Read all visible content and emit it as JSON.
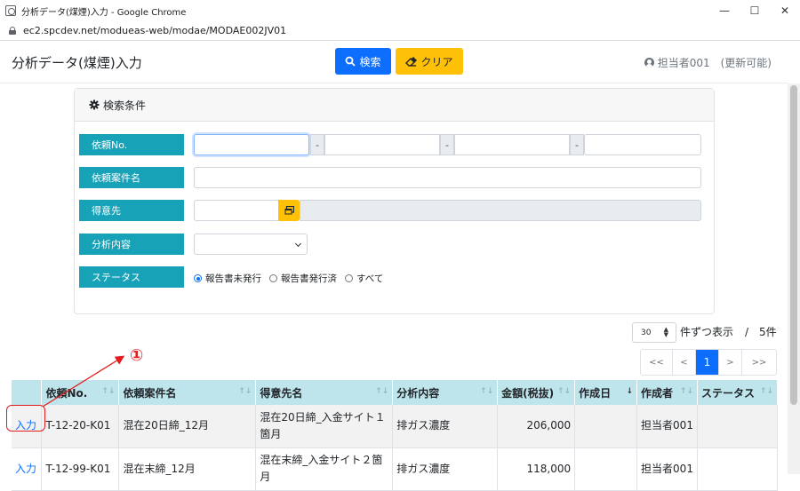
{
  "window": {
    "title": "分析データ(煤煙)入力 - Google Chrome",
    "url": "ec2.spcdev.net/modueas-web/modae/MODAE002JV01",
    "minimize": "—",
    "maximize": "☐",
    "close": "✕"
  },
  "header": {
    "title": "分析データ(煤煙)入力",
    "search_label": "検索",
    "clear_label": "クリア",
    "user": "担当者001　(更新可能)"
  },
  "search": {
    "title": "検索条件",
    "labels": {
      "request_no": "依頼No.",
      "case_name": "依頼案件名",
      "customer": "得意先",
      "analysis": "分析内容",
      "status": "ステータス"
    },
    "separator": "-",
    "status_options": [
      {
        "label": "報告書未発行",
        "checked": true
      },
      {
        "label": "報告書発行済",
        "checked": false
      },
      {
        "label": "すべて",
        "checked": false
      }
    ]
  },
  "paging": {
    "per_page": "30",
    "per_page_text": "件ずつ表示",
    "count": "/　5件",
    "pages": [
      "<<",
      "<",
      "1",
      ">",
      ">>"
    ],
    "current": "1"
  },
  "table": {
    "columns": [
      "",
      "依頼No.",
      "依頼案件名",
      "得意先名",
      "分析内容",
      "金額(税抜)",
      "作成日",
      "作成者",
      "ステータス"
    ],
    "rows": [
      {
        "action": "入力",
        "no": "T-12-20-K01",
        "case": "混在20日締_12月",
        "customer": "混在20日締_入金サイト１箇月",
        "analysis": "排ガス濃度",
        "amount": "206,000",
        "date": "",
        "creator": "担当者001",
        "status": ""
      },
      {
        "action": "入力",
        "no": "T-12-99-K01",
        "case": "混在末締_12月",
        "customer": "混在末締_入金サイト２箇月",
        "analysis": "排ガス濃度",
        "amount": "118,000",
        "date": "",
        "creator": "担当者001",
        "status": ""
      }
    ]
  },
  "annotation": {
    "marker": "①",
    "color": "#e31b1b"
  }
}
